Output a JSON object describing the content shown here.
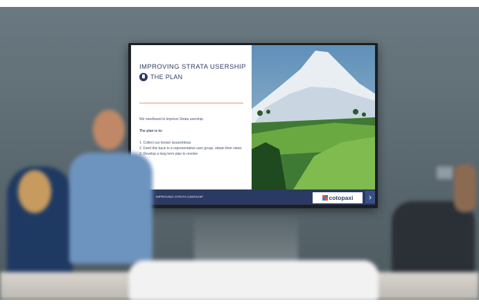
{
  "slide": {
    "title": "IMPROVING STRATA USERSHIP",
    "subtitle": "THE PLAN",
    "intro": "We need/want to improve Strata usership.",
    "plan_heading": "The plan is to:",
    "steps": [
      "1. Collect our known issues/ideas",
      "2. Feed this back to a representative user group, obtain their views",
      "3. Develop a long term plan to resolve"
    ],
    "footer_label": "IMPROVING STRATA USERSHIP",
    "brand": "cotopaxi",
    "next_glyph": "›",
    "photo": "snow-capped-volcano-over-green-hills"
  },
  "colors": {
    "navy": "#2b3a63",
    "accent_rule": "#e39a6a",
    "logo_orange": "#f05a28",
    "logo_blue": "#3a7bd5"
  }
}
